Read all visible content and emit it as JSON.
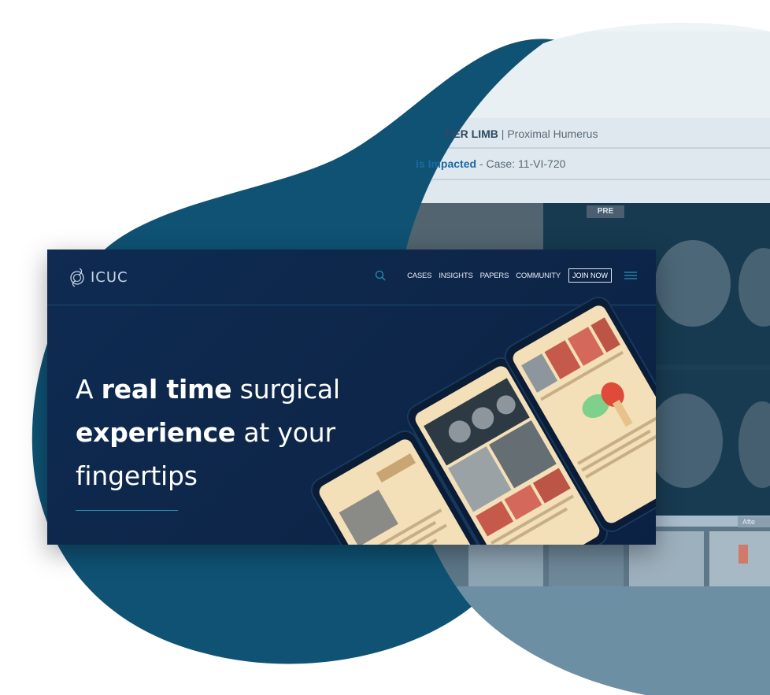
{
  "case_view": {
    "breadcrumb_section": "PER LIMB",
    "breadcrumb_separator": "|",
    "breadcrumb_region": "Proximal Humerus",
    "case_classification": "is Impacted",
    "case_separator": "-",
    "case_id": "Case: 11-VI-720",
    "pre_label": "PRE",
    "after_label": "Afte"
  },
  "site": {
    "logo_text": "ICUC",
    "nav": {
      "cases": "CASES",
      "insights": "INSIGHTS",
      "papers": "PAPERS",
      "community": "COMMUNITY",
      "join": "JOIN NOW"
    },
    "headline": {
      "part1": "A ",
      "bold1": "real time",
      "part2": " surgical",
      "bold2": "experience",
      "part3": " at your",
      "part4": "fingertips"
    }
  },
  "colors": {
    "blob_dark": "#0e5173",
    "blob_light": "#d9e6ee",
    "site_bg": "#0f2b52",
    "accent_line": "#2c8fb3",
    "phone_screen": "#f3dfb8"
  },
  "icons": [
    "logo-mark-icon",
    "search-icon",
    "hamburger-menu-icon"
  ]
}
